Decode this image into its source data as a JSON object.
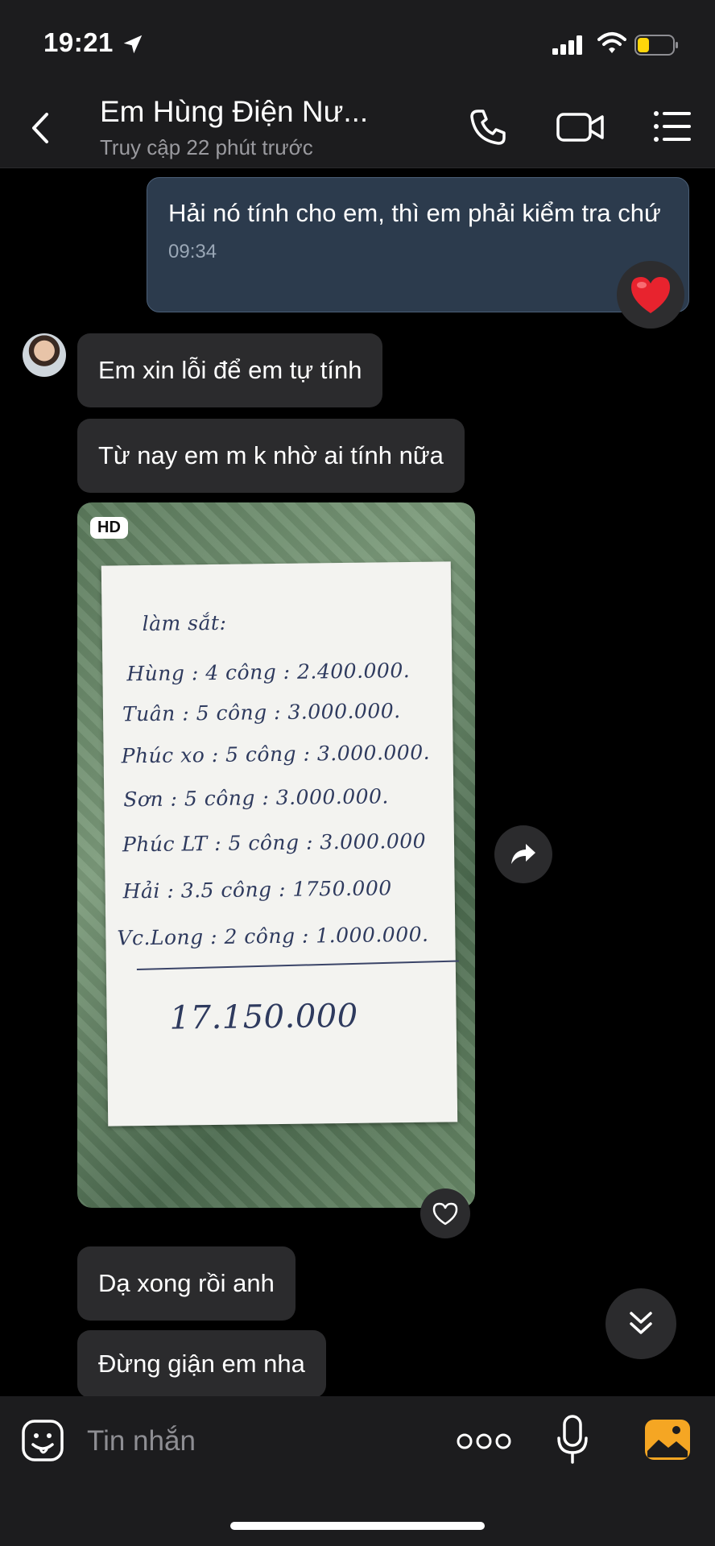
{
  "status_bar": {
    "time": "19:21"
  },
  "header": {
    "contact_name": "Em Hùng Điện Nư...",
    "last_seen": "Truy cập 22 phút trước"
  },
  "messages": {
    "outgoing": {
      "text": "Hải nó tính cho em, thì em phải kiểm tra chứ",
      "time": "09:34",
      "reaction": "heart"
    },
    "incoming": [
      {
        "text": "Em xin lỗi để em tự tính"
      },
      {
        "text": "Từ nay em m k nhờ ai tính nữa"
      },
      {
        "text": "Dạ xong rồi anh"
      },
      {
        "text": "Đừng giận em nha"
      }
    ],
    "photo": {
      "badge": "HD",
      "handwriting": {
        "heading": "làm sắt:",
        "lines": [
          "Hùng  : 4 công : 2.400.000.",
          "Tuân  : 5 công : 3.000.000.",
          "Phúc xo : 5 công : 3.000.000.",
          "Sơn    : 5 công : 3.000.000.",
          "Phúc LT : 5 công : 3.000.000",
          "Hải    : 3.5 công : 1750.000",
          "Vc.Long : 2 công : 1.000.000."
        ],
        "total": "17.150.000"
      }
    }
  },
  "input": {
    "placeholder": "Tin nhắn"
  },
  "colors": {
    "background": "#000000",
    "bar": "#1c1c1e",
    "bubble_in": "#2b2b2d",
    "bubble_out": "#2c3b4d",
    "accent_orange": "#f5a623",
    "heart": "#e8232e"
  }
}
